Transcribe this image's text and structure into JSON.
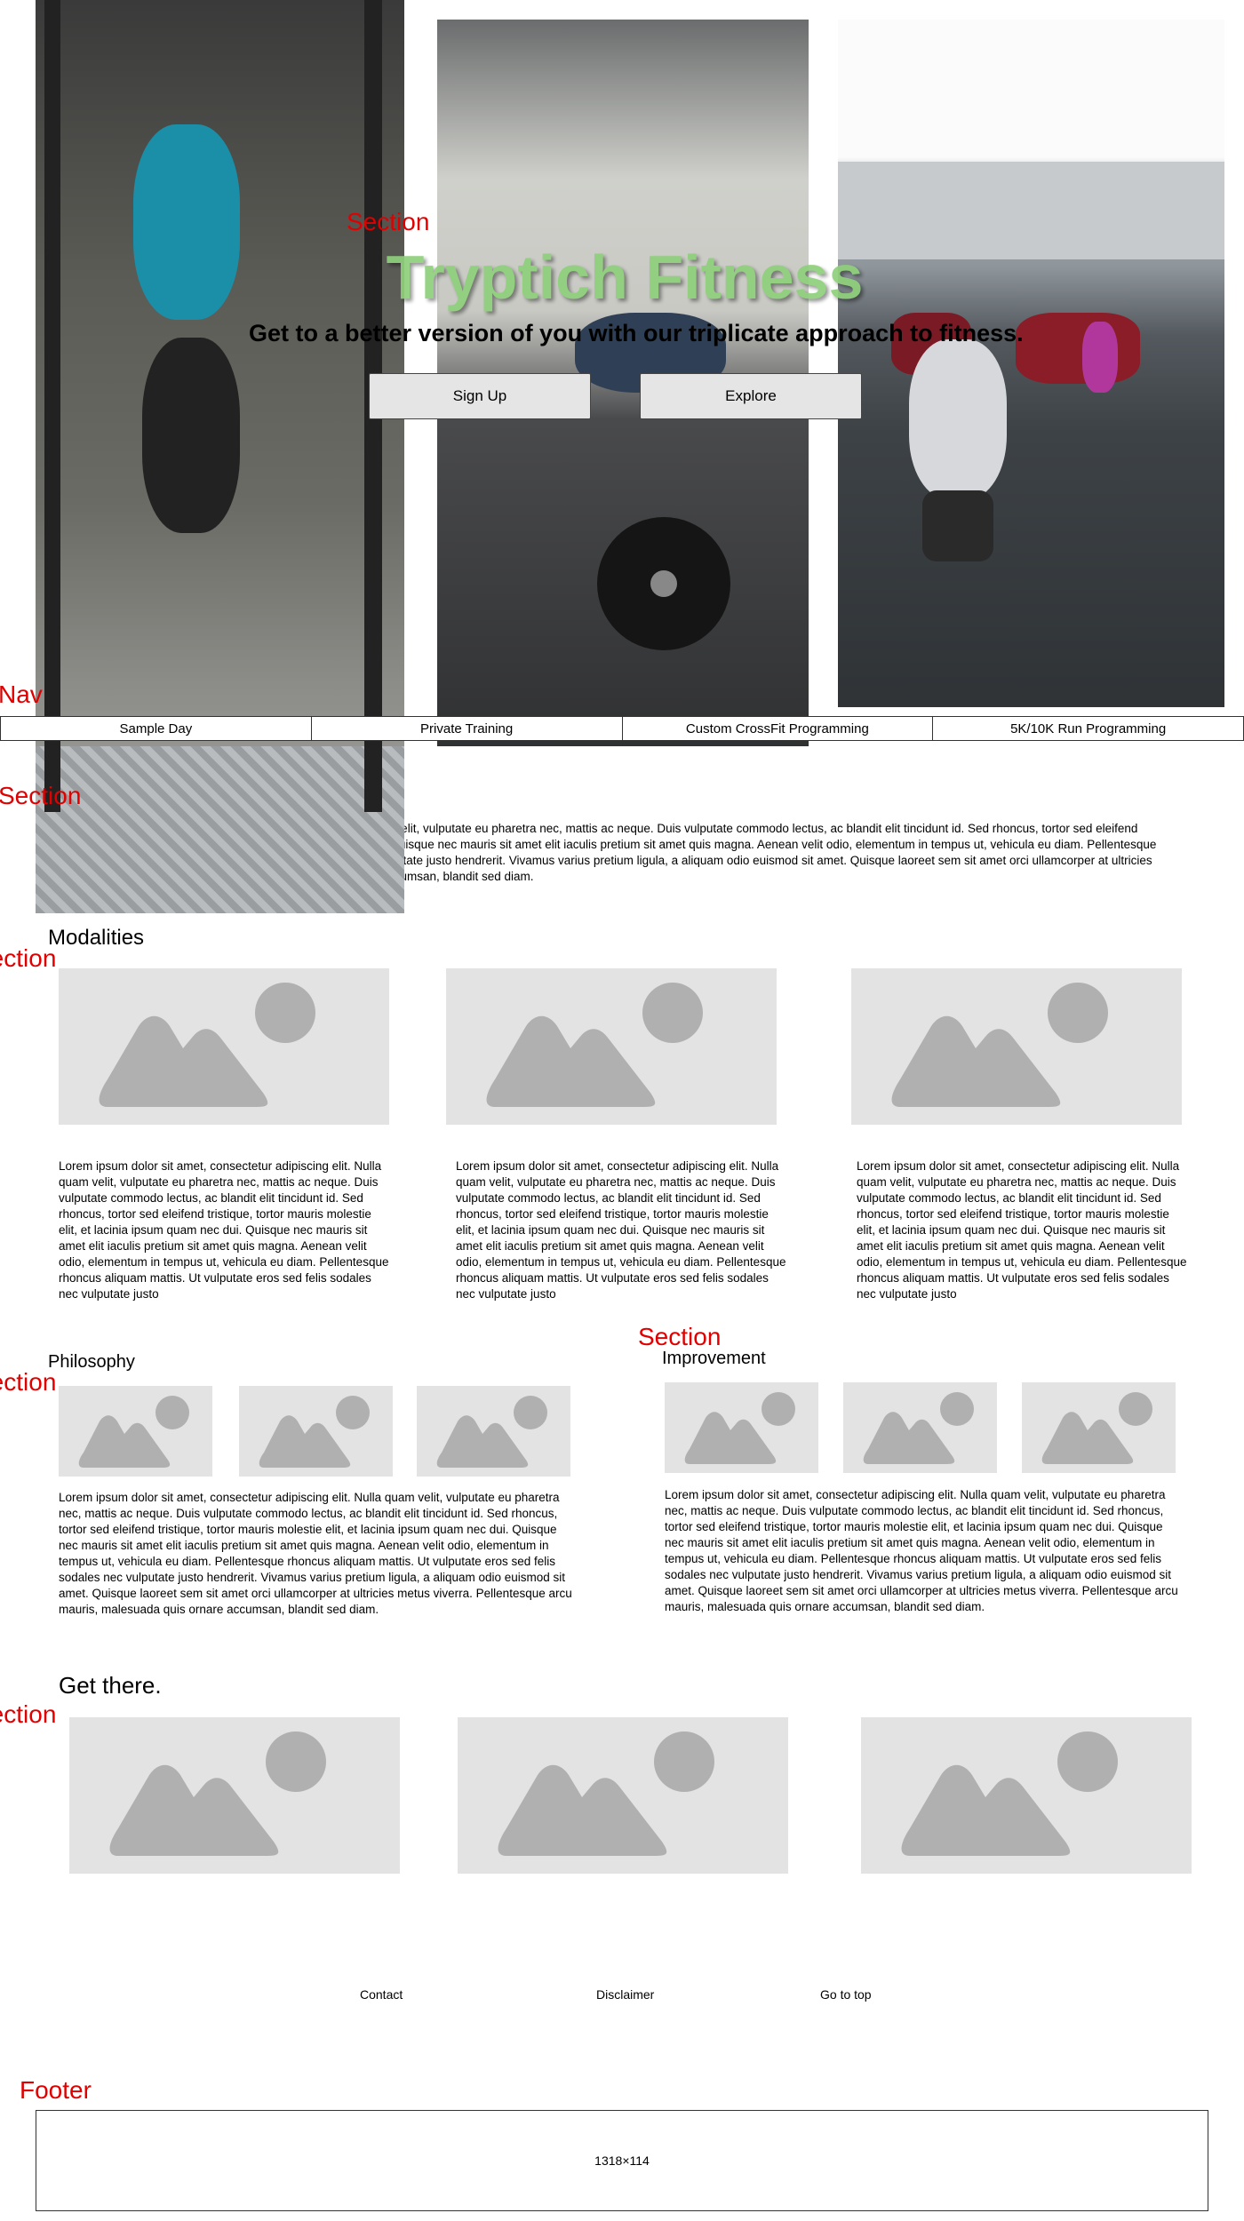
{
  "labels": {
    "section": "Section",
    "nav": "Nav",
    "footer": "Footer"
  },
  "hero": {
    "title": "Tryptich Fitness",
    "subtitle": "Get to a better version of you with our triplicate approach to fitness.",
    "signup_label": "Sign Up",
    "explore_label": "Explore"
  },
  "nav": {
    "items": [
      {
        "label": "Sample Day"
      },
      {
        "label": "Private Training"
      },
      {
        "label": "Custom CrossFit Programming"
      },
      {
        "label": "5K/10K Run Programming"
      }
    ]
  },
  "intro": {
    "text": "Lorem ipsum dolor sit amet, consectetur adipiscing elit. Nulla quam velit, vulputate eu pharetra nec, mattis ac neque. Duis vulputate commodo lectus, ac blandit elit tincidunt id. Sed rhoncus, tortor sed eleifend tristique, tortor mauris molestie elit, et lacinia ipsum quam nec dui. Quisque nec mauris sit amet elit iaculis pretium sit amet quis magna. Aenean velit odio, elementum in tempus ut, vehicula eu diam. Pellentesque rhoncus aliquam mattis. Ut vulputate eros sed felis sodales nec vulputate justo hendrerit. Vivamus varius pretium ligula, a aliquam odio euismod sit amet. Quisque laoreet sem sit amet orci ullamcorper at ultricies metus viverra. Pellentesque arcu mauris, malesuada quis ornare accumsan, blandit sed diam."
  },
  "modalities": {
    "heading": "Modalities",
    "text": "Lorem ipsum dolor sit amet, consectetur adipiscing elit. Nulla quam velit, vulputate eu pharetra nec, mattis ac neque. Duis vulputate commodo lectus, ac blandit elit tincidunt id. Sed rhoncus, tortor sed eleifend tristique, tortor mauris molestie elit, et lacinia ipsum quam nec dui. Quisque nec mauris sit amet elit iaculis pretium sit amet quis magna. Aenean velit odio, elementum in tempus ut, vehicula eu diam. Pellentesque rhoncus aliquam mattis. Ut vulputate eros sed felis sodales nec vulputate justo"
  },
  "philosophy": {
    "heading": "Philosophy",
    "text": "Lorem ipsum dolor sit amet, consectetur adipiscing elit. Nulla quam velit, vulputate eu pharetra nec, mattis ac neque. Duis vulputate commodo lectus, ac blandit elit tincidunt id. Sed rhoncus, tortor sed eleifend tristique, tortor mauris molestie elit, et lacinia ipsum quam nec dui. Quisque nec mauris sit amet elit iaculis pretium sit amet quis magna. Aenean velit odio, elementum in tempus ut, vehicula eu diam. Pellentesque rhoncus aliquam mattis. Ut vulputate eros sed felis sodales nec vulputate justo hendrerit. Vivamus varius pretium ligula, a aliquam odio euismod sit amet. Quisque laoreet sem sit amet orci ullamcorper at ultricies metus viverra. Pellentesque arcu mauris, malesuada quis ornare accumsan, blandit sed diam."
  },
  "improvement": {
    "heading": "Improvement",
    "text": "Lorem ipsum dolor sit amet, consectetur adipiscing elit. Nulla quam velit, vulputate eu pharetra nec, mattis ac neque. Duis vulputate commodo lectus, ac blandit elit tincidunt id. Sed rhoncus, tortor sed eleifend tristique, tortor mauris molestie elit, et lacinia ipsum quam nec dui. Quisque nec mauris sit amet elit iaculis pretium sit amet quis magna. Aenean velit odio, elementum in tempus ut, vehicula eu diam. Pellentesque rhoncus aliquam mattis. Ut vulputate eros sed felis sodales nec vulputate justo hendrerit. Vivamus varius pretium ligula, a aliquam odio euismod sit amet. Quisque laoreet sem sit amet orci ullamcorper at ultricies metus viverra. Pellentesque arcu mauris, malesuada quis ornare accumsan, blandit sed diam."
  },
  "get_there": {
    "heading": "Get there."
  },
  "footer": {
    "links": {
      "contact": "Contact",
      "disclaimer": "Disclaimer",
      "go_to_top": "Go to top"
    },
    "placeholder": "1318×114"
  },
  "colors": {
    "label_red": "#e00000",
    "hero_title_green": "#8fd07b",
    "placeholder_bg": "#e3e3e3",
    "placeholder_icon": "#b0b0b0"
  },
  "icons": {
    "placeholder": "image-placeholder-icon"
  }
}
